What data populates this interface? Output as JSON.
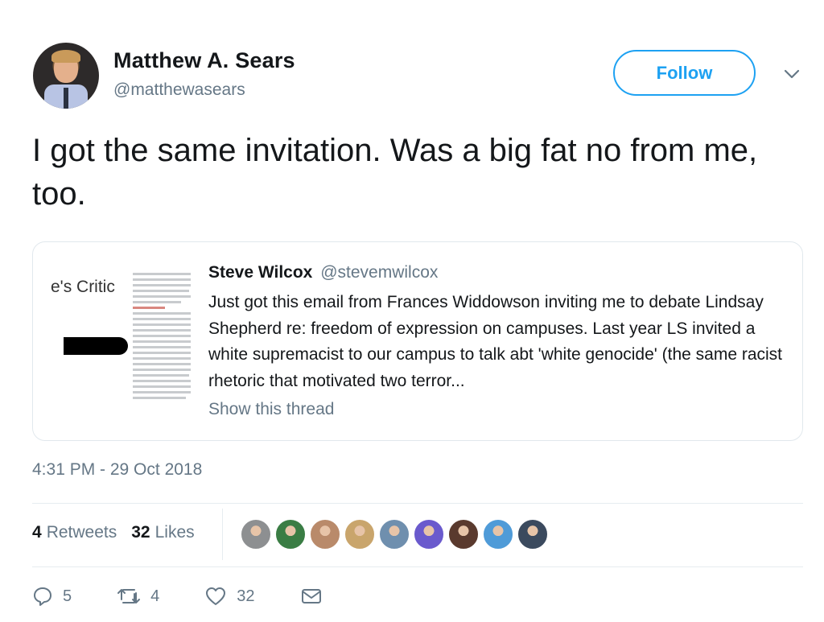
{
  "author": {
    "name": "Matthew A. Sears",
    "handle": "@matthewasears"
  },
  "follow_label": "Follow",
  "tweet_text": "I got the same invitation. Was a big fat no from me, too.",
  "quoted": {
    "media_text": "e's Critic",
    "name": "Steve Wilcox",
    "handle": "@stevemwilcox",
    "text": "Just got this email from Frances Widdowson inviting me to debate Lindsay Shepherd re: freedom of expression on campuses. Last year LS invited a white supremacist to our campus to talk abt 'white genocide' (the same racist rhetoric that motivated two terror...",
    "show_thread": "Show this thread"
  },
  "timestamp": "4:31 PM - 29 Oct 2018",
  "stats": {
    "retweets_count": "4",
    "retweets_label": "Retweets",
    "likes_count": "32",
    "likes_label": "Likes"
  },
  "liker_colors": [
    "#8d8f91",
    "#3a7d44",
    "#b98a6a",
    "#c9a56c",
    "#6f8fae",
    "#6a5acd",
    "#5a3a2e",
    "#4f9bd8",
    "#3b4a5e"
  ],
  "actions": {
    "reply_count": "5",
    "retweet_count": "4",
    "like_count": "32"
  },
  "colors": {
    "accent": "#1da1f2",
    "secondary_text": "#657786"
  }
}
